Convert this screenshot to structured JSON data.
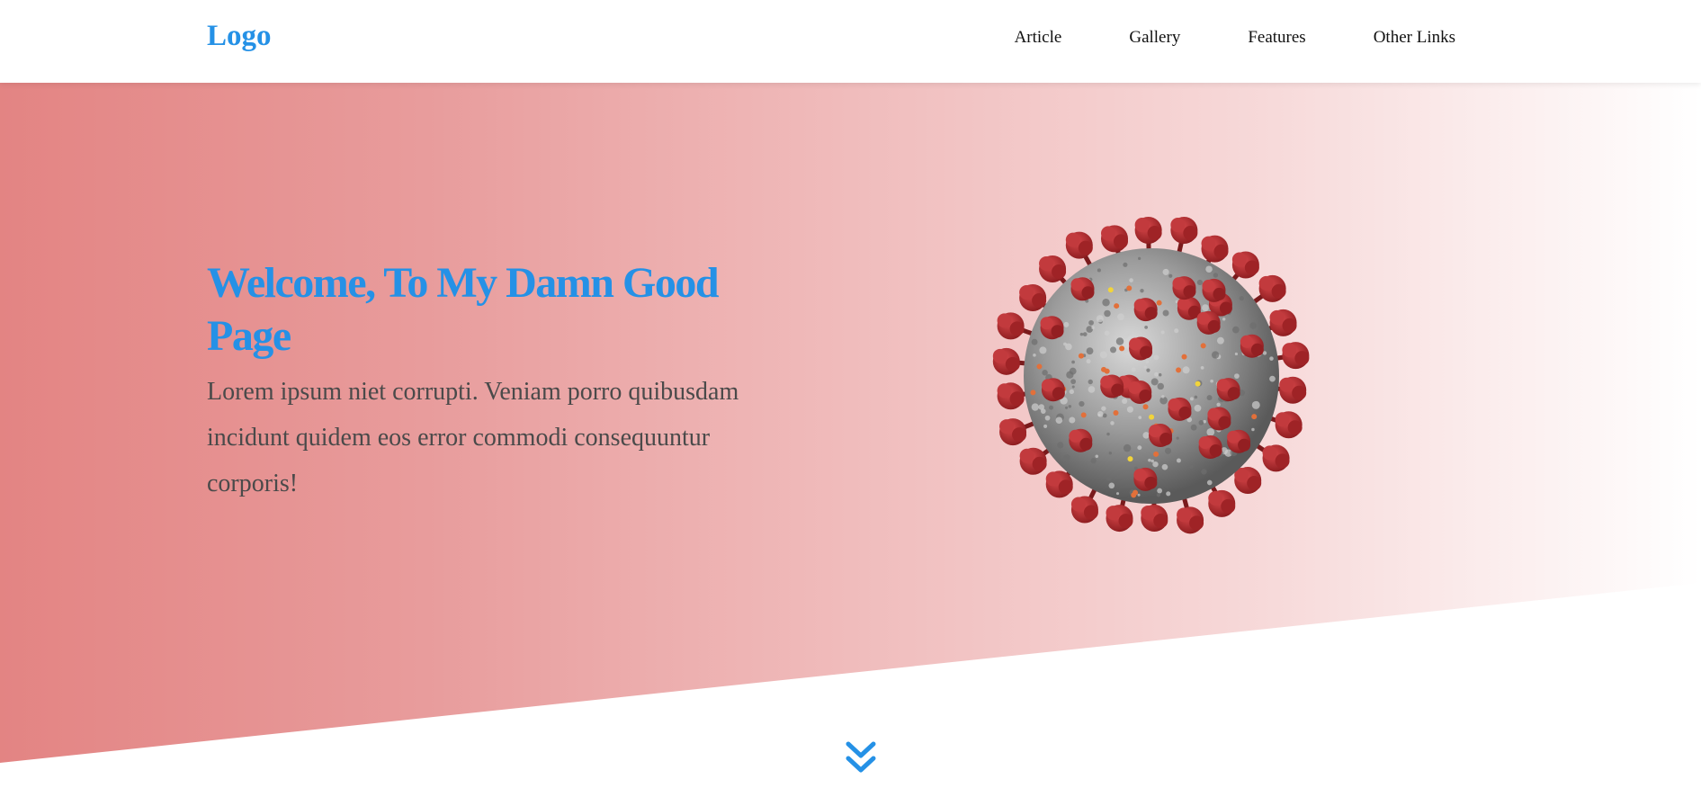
{
  "header": {
    "logo": "Logo",
    "nav": [
      {
        "label": "Article"
      },
      {
        "label": "Gallery"
      },
      {
        "label": "Features"
      },
      {
        "label": "Other Links"
      }
    ]
  },
  "hero": {
    "title": "Welcome, To My Damn Good Page",
    "text": "Lorem ipsum niet corrupti. Veniam porro quibusdam incidunt quidem eos error commodi consequuntur corporis!",
    "image": "coronavirus-illustration"
  },
  "scroll_icon": "double-chevron-down-icon",
  "colors": {
    "accent": "#2591e6",
    "hero_gradient_start": "#e38483",
    "hero_gradient_end": "#ffffff",
    "virus_spike": "#b0292d",
    "virus_body": "#9a9a9a"
  }
}
